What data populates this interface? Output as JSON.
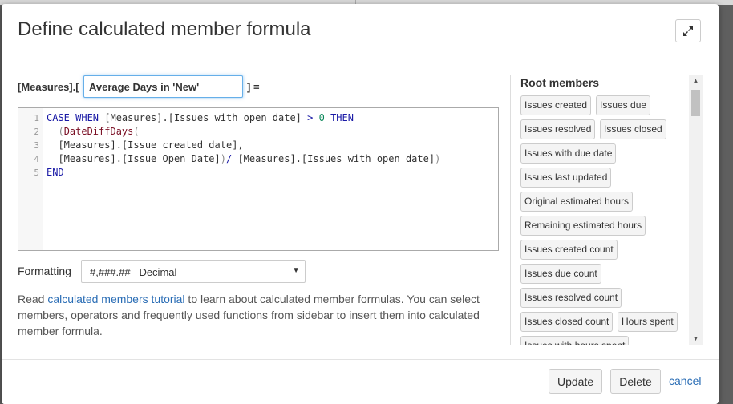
{
  "dialog": {
    "title": "Define calculated member formula",
    "icons": {
      "expand": "expand-arrows-icon"
    }
  },
  "member": {
    "prefix": "[Measures].[",
    "name_value": "Average Days in 'New'",
    "suffix": "] ="
  },
  "editor": {
    "line_numbers": [
      "1",
      "2",
      "3",
      "4",
      "5"
    ]
  },
  "formatting": {
    "label": "Formatting",
    "selected": "#,###.##   Decimal"
  },
  "help": {
    "before_link": "Read ",
    "link_text": "calculated members tutorial",
    "after_link": " to learn about calculated member formulas. You can select members, operators and frequently used functions from sidebar to insert them into calculated member formula."
  },
  "sidebar": {
    "title": "Root members",
    "chips": [
      "Issues created",
      "Issues due",
      "Issues resolved",
      "Issues closed",
      "Issues with due date",
      "Issues last updated",
      "Original estimated hours",
      "Remaining estimated hours",
      "Issues created count",
      "Issues due count",
      "Issues resolved count",
      "Issues closed count",
      "Hours spent",
      "Issues with hours spent"
    ]
  },
  "footer": {
    "update_label": "Update",
    "delete_label": "Delete",
    "cancel_label": "cancel"
  },
  "colors": {
    "link": "#2a6db5",
    "keyword": "#1a1aa6",
    "function": "#7a0f24",
    "focus_border": "#66afe9"
  }
}
